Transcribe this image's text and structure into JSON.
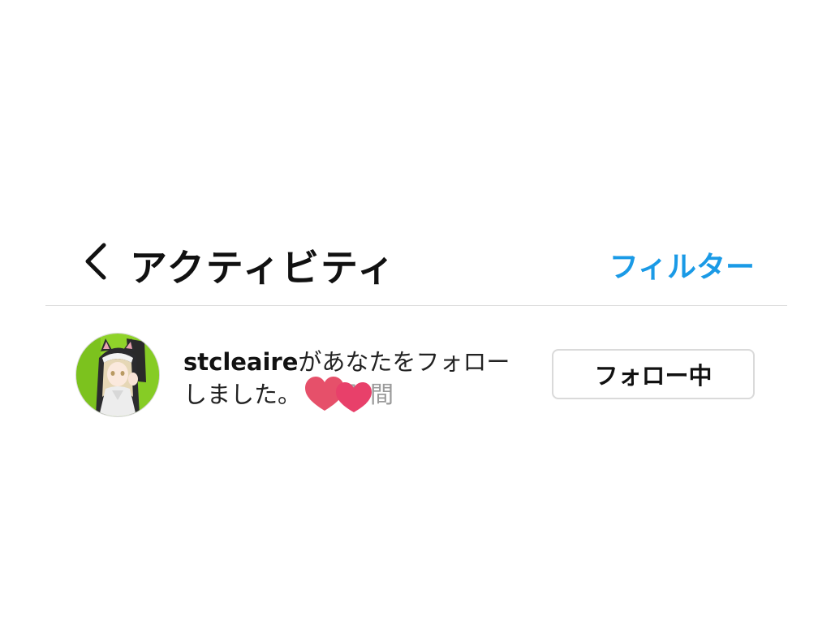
{
  "header": {
    "back_icon": "chevron-left-icon",
    "title": "アクティビティ",
    "filter_label": "フィルター",
    "accent_color": "#1a9ae6"
  },
  "activity": {
    "avatar_icon": "user-avatar",
    "username": "stcleaire",
    "message_line1": "があなたをフォロー",
    "message_line2": "しました。",
    "timestamp": "時間",
    "follow_button_label": "フォロー中",
    "sticker_icon": "heart-stickers-icon"
  }
}
